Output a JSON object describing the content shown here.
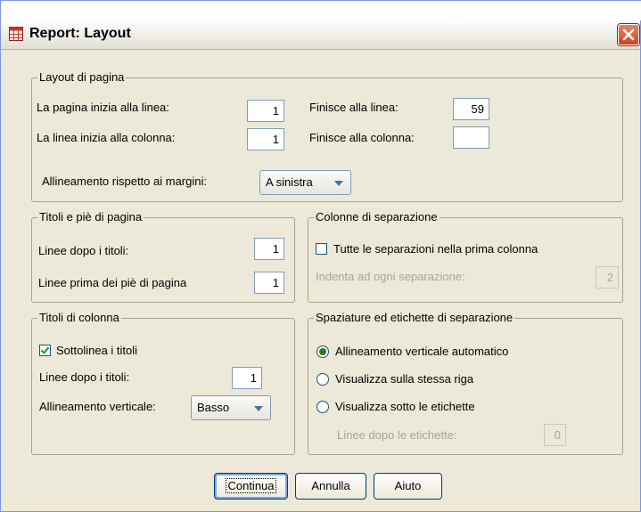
{
  "window": {
    "title": "Report: Layout",
    "top_text": ""
  },
  "page_layout": {
    "legend": "Layout di pagina",
    "start_line_label": "La pagina inizia alla linea:",
    "start_line_value": "1",
    "end_line_label": "Finisce alla linea:",
    "end_line_value": "59",
    "line_start_col_label": "La linea inizia alla colonna:",
    "line_start_col_value": "1",
    "end_col_label": "Finisce alla colonna:",
    "end_col_value": "",
    "align_label": "Allineamento rispetto ai margini:",
    "align_value": "A sinistra"
  },
  "titles_footers": {
    "legend": "Titoli e piè di pagina",
    "lines_after_titles_label": "Linee dopo i titoli:",
    "lines_after_titles_value": "1",
    "lines_before_footers_label": "Linee prima dei piè di pagina",
    "lines_before_footers_value": "1"
  },
  "break_columns": {
    "legend": "Colonne di separazione",
    "all_breaks_label": "Tutte le separazioni nella prima colonna",
    "all_breaks_checked": false,
    "indent_label": "Indenta ad ogni separazione:",
    "indent_value": "2"
  },
  "column_titles": {
    "legend": "Titoli di colonna",
    "underline_label": "Sottolinea i titoli",
    "underline_checked": true,
    "lines_after_titles_label": "Linee dopo i titoli:",
    "lines_after_titles_value": "1",
    "vertical_align_label": "Allineamento verticale:",
    "vertical_align_value": "Basso"
  },
  "break_spacing": {
    "legend": "Spaziature ed etichette di separazione",
    "options": [
      "Allineamento verticale automatico",
      "Visualizza sulla stessa riga",
      "Visualizza sotto le etichette"
    ],
    "selected_index": 0,
    "lines_after_labels_label": "Linee dopo le etichette:",
    "lines_after_labels_value": "0"
  },
  "buttons": {
    "continue": "Continua",
    "cancel": "Annulla",
    "help": "Aiuto"
  },
  "colors": {
    "accent": "#2f7b19",
    "close": "#c9431f"
  }
}
